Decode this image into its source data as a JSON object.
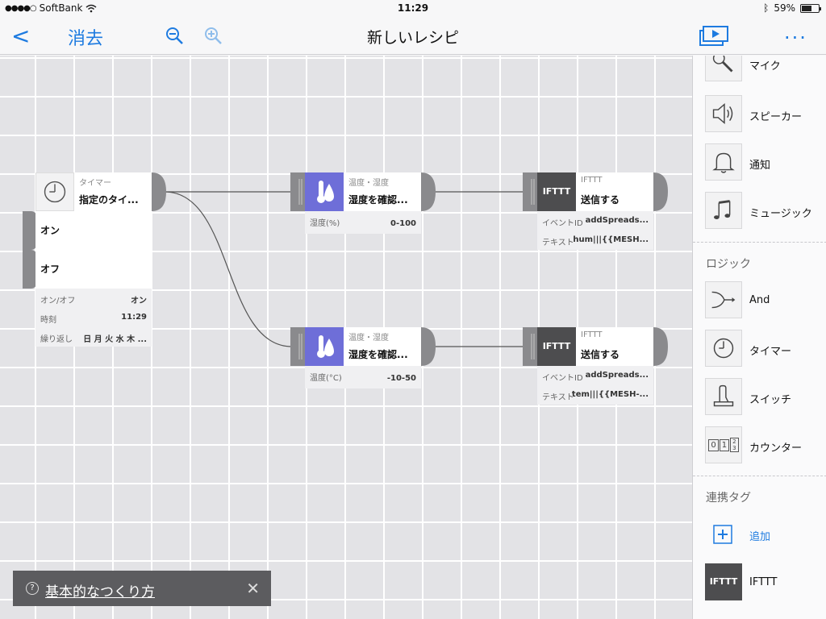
{
  "status": {
    "carrier": "SoftBank",
    "time": "11:29",
    "battery": "59%",
    "battery_level": 0.59
  },
  "nav": {
    "back_glyph": "<",
    "cancel": "消去",
    "title": "新しいレシピ",
    "more": "..."
  },
  "blocks": {
    "timer": {
      "category": "タイマー",
      "name": "指定のタイ...",
      "outputs": [
        "オン",
        "オフ"
      ],
      "props": [
        {
          "k": "オン/オフ",
          "v": "オン"
        },
        {
          "k": "時刻",
          "v": "11:29"
        },
        {
          "k": "繰り返し",
          "v": "日 月 火 水 木 ..."
        }
      ]
    },
    "temp1": {
      "category": "温度・湿度",
      "name": "湿度を確認...",
      "prop": {
        "k": "湿度(%)",
        "v": "0-100"
      }
    },
    "temp2": {
      "category": "温度・湿度",
      "name": "湿度を確認...",
      "prop": {
        "k": "温度(°C)",
        "v": "-10-50"
      }
    },
    "ifttt1": {
      "category": "IFTTT",
      "name": "送信する",
      "icon_text": "IFTTT",
      "props": [
        {
          "k": "イベントID",
          "v": "addSpreads..."
        },
        {
          "k": "テキスト",
          "v": "hum|||{{MESH..."
        }
      ]
    },
    "ifttt2": {
      "category": "IFTTT",
      "name": "送信する",
      "icon_text": "IFTTT",
      "props": [
        {
          "k": "イベントID",
          "v": "addSpreads..."
        },
        {
          "k": "テキスト",
          "v": "tem|||{{MESH-..."
        }
      ]
    }
  },
  "help": {
    "text": "基本的なつくり方",
    "q": "?"
  },
  "sidebar": {
    "items_top": [
      {
        "label": "マイク",
        "icon": "microphone-icon"
      },
      {
        "label": "スピーカー",
        "icon": "speaker-icon"
      },
      {
        "label": "通知",
        "icon": "bell-icon"
      },
      {
        "label": "ミュージック",
        "icon": "music-note-icon"
      }
    ],
    "logic_title": "ロジック",
    "logic_items": [
      {
        "label": "And",
        "icon": "and-merge-icon"
      },
      {
        "label": "タイマー",
        "icon": "timer-icon"
      },
      {
        "label": "スイッチ",
        "icon": "switch-lever-icon"
      },
      {
        "label": "カウンター",
        "icon": "counter-icon"
      }
    ],
    "tags_title": "連携タグ",
    "add_label": "追加",
    "ifttt_label": "IFTTT",
    "ifttt_icon_text": "IFTTT",
    "counter_digits": [
      "0",
      "1",
      "2",
      "3"
    ]
  },
  "colors": {
    "accent": "#1e7be0",
    "sensor_blue": "#6e6ed8",
    "ifttt_dark": "#4d4d4f",
    "connector": "#8a8a8d"
  }
}
